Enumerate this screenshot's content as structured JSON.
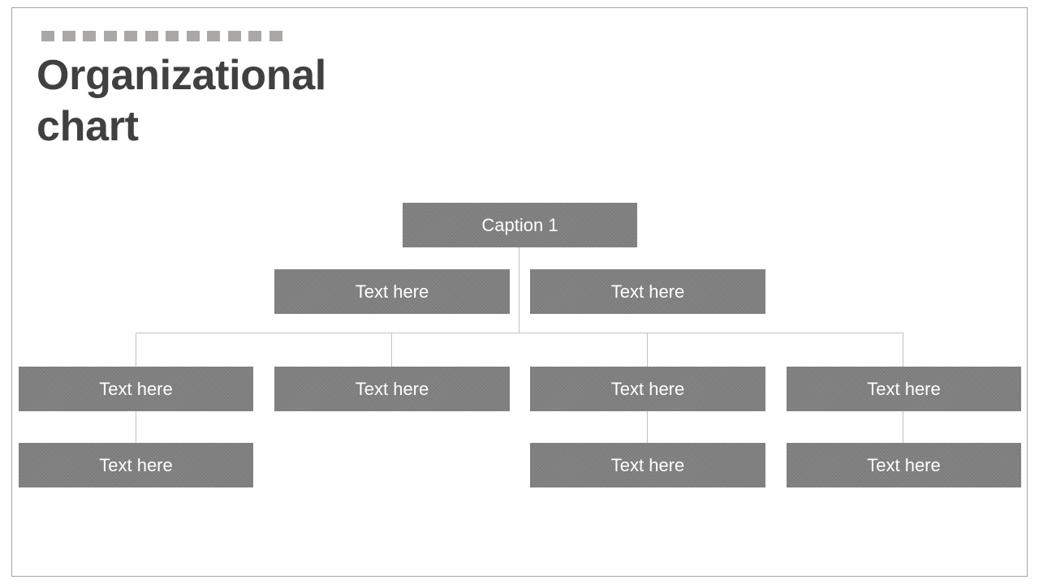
{
  "slide": {
    "title_line1": "Organizational",
    "title_line2": "chart",
    "decorative_squares": 12
  },
  "colors": {
    "box": "#808080",
    "box_text": "#ffffff",
    "title": "#404040",
    "connector": "#c3c3c3",
    "decor": "#aaa7a7"
  },
  "org": {
    "root": {
      "label": "Caption 1"
    },
    "level2": [
      {
        "label": "Text here"
      },
      {
        "label": "Text here"
      }
    ],
    "level3": [
      {
        "label": "Text here",
        "children": [
          {
            "label": "Text here"
          }
        ]
      },
      {
        "label": "Text here",
        "children": []
      },
      {
        "label": "Text here",
        "children": [
          {
            "label": "Text here"
          }
        ]
      },
      {
        "label": "Text here",
        "children": [
          {
            "label": "Text here"
          }
        ]
      }
    ]
  }
}
